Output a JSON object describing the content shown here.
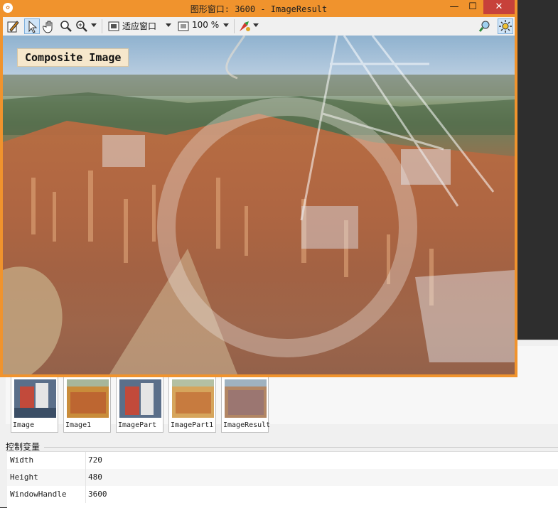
{
  "window": {
    "title": "图形窗口: 3600 - ImageResult",
    "app_icon": "halcon-icon",
    "buttons": {
      "minimize": "—",
      "maximize": "☐",
      "close": "✕"
    }
  },
  "toolbar": {
    "fit_label": "适应窗口",
    "zoom_label": "100 %",
    "icons": [
      "edit-icon",
      "pointer-icon",
      "hand-icon",
      "zoom-icon",
      "zoom-plus-icon",
      "fit-icon",
      "zoom-box-icon",
      "color-icon",
      "inspect-icon",
      "settings-icon"
    ]
  },
  "canvas": {
    "label": "Composite Image"
  },
  "thumbnails": [
    {
      "label": "Image"
    },
    {
      "label": "Image1"
    },
    {
      "label": "ImagePart"
    },
    {
      "label": "ImagePart1"
    },
    {
      "label": "ImageResult"
    }
  ],
  "variables": {
    "title": "控制变量",
    "rows": [
      {
        "name": "Width",
        "value": "720"
      },
      {
        "name": "Height",
        "value": "480"
      },
      {
        "name": "WindowHandle",
        "value": "3600"
      }
    ]
  }
}
